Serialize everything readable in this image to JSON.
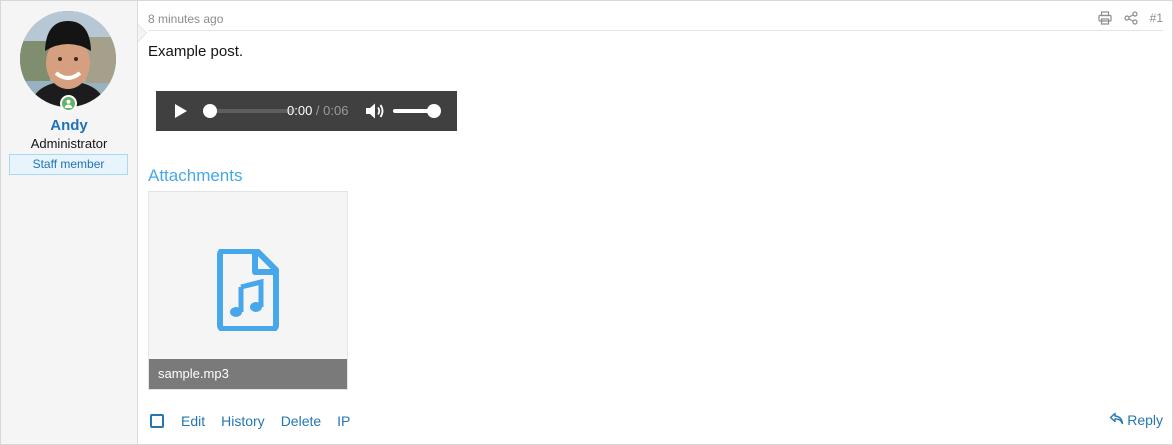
{
  "user": {
    "name": "Andy",
    "title": "Administrator",
    "badge": "Staff member",
    "status": "online"
  },
  "post": {
    "time": "8 minutes ago",
    "number": "#1",
    "message": "Example post."
  },
  "audio": {
    "current_time": "0:00",
    "separator": " / ",
    "duration": "0:06",
    "progress": 0,
    "volume": 1
  },
  "attachments": {
    "heading": "Attachments",
    "items": [
      {
        "filename": "sample.mp3",
        "icon": "file-audio-icon"
      }
    ]
  },
  "actions": {
    "edit": "Edit",
    "history": "History",
    "delete": "Delete",
    "ip": "IP",
    "reply": "Reply"
  },
  "icons": {
    "print": "print-icon",
    "share": "share-icon",
    "reply": "reply-icon"
  },
  "colors": {
    "link": "#2577b1",
    "accent": "#47a7eb",
    "online": "#63b265",
    "player_bg": "#404040"
  }
}
